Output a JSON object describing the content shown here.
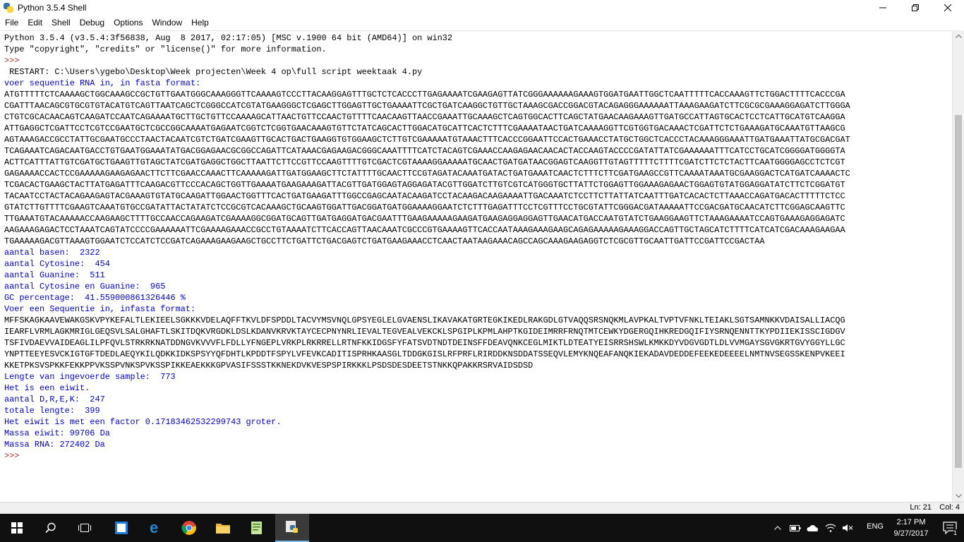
{
  "window": {
    "title": "Python 3.5.4 Shell"
  },
  "menu": [
    "File",
    "Edit",
    "Shell",
    "Debug",
    "Options",
    "Window",
    "Help"
  ],
  "shell": {
    "lines": [
      {
        "type": "output",
        "text": "Python 3.5.4 (v3.5.4:3f56838, Aug  8 2017, 02:17:05) [MSC v.1900 64 bit (AMD64)] on win32"
      },
      {
        "type": "output",
        "text": "Type \"copyright\", \"credits\" or \"license()\" for more information."
      },
      {
        "type": "prompt",
        "text": ">>> "
      },
      {
        "type": "output",
        "text": " RESTART: C:\\Users\\ygebo\\Desktop\\Week projecten\\Week 4 op\\full script weektaak 4.py"
      },
      {
        "type": "blue",
        "text": "voer sequentie RNA in, in fasta format:"
      },
      {
        "type": "output",
        "text": "ATGTTTTTCTCAAAAGCTGGCAAAGCCGCTGTTGAATGGGCAAAGGGTTCAAAAGTCCCTTACAAGGAGTTTGCTCTCACCCTTGAGAAAATCGAAGAGTTATCGGGAAAAAAGAAAGTGGATGAATTGGCTCAATTTTTCACCAAAGTTCTGGACTTTTCACCCGA"
      },
      {
        "type": "output",
        "text": "CGATTTAACAGCGTGCGTGTACATGTCAGTTAATCAGCTCGGGCCATCGTATGAAGGGCTCGAGCTTGGAGTTGCTGAAAATTCGCTGATCAAGGCTGTTGCTAAAGCGACCGGACGTACAGAGGGAAAAAATTAAAGAAGATCTTCGCGCGAAAGGAGATCTTGGGA"
      },
      {
        "type": "output",
        "text": "CTGTCGCACAACAGTCAAGATCCAATCAGAAAATGCTTGCTGTTCCAAAAGCATTAACTGTTCCAACTGTTTTCAACAAGTTAACCGAAATTGCAAAGCTCAGTGGCACTTCAGCTATGAACAAGAAAGTTGATGCCATTAGTGCACTCCTCATTGCATGTCAAGGA"
      },
      {
        "type": "output",
        "text": "ATTGAGGCTCGATTCCTCGTCCGAATGCTCGCCGGCAAAATGAGAATCGGTCTCGGTGAACAAAGTGTTCTATCAGCACTTGGACATGCATTCACTCTTTCGAAAATAACTGATCAAAAGGTTCGTGGTGACAAACTCGATTCTCTGAAAGATGCAAATGTTAAGCG"
      },
      {
        "type": "output",
        "text": "AGTAAAGACCGCCTATTGCGAATGCCCTAACTACAATCGTCTGATCGAAGTTGCACTGACTGAAGGTGTGGAAGCTCTTGTCGAAAAATGTAAACTTTCACCCGGAATTCCACTGAAACCTATGCTGGCTCACCCTACAAAGGGAAATTGATGAAATTATGCGACGAT"
      },
      {
        "type": "output",
        "text": "TCAGAAATCAGACAATGACCTGTGAATGGAAATATGACGGAGAACGCGGCCAGATTCATAAACGAGAAGACGGGCAAATTTTCATCTACAGTCGAAACCAAGAGAACAACACTACCAAGTACCCCGATATTATCGAAAAAATTTCATCCTGCATCGGGGATGGGGTA"
      },
      {
        "type": "output",
        "text": "ACTTCATTTATTGTCGATGCTGAAGTTGTAGCTATCGATGAGGCTGGCTTAATTCTTCCGTTCCAAGTTTTGTCGACTCGTAAAAGGAAAAATGCAACTGATGATAACGGAGTCAAGGTTGTAGTTTTTCTTTTCGATCTTCTCTACTTCAATGGGGAGCCTCTCGT"
      },
      {
        "type": "output",
        "text": "GAGAAAACCACTCCGAAAAAGAAGAGAACTTCTTCGAACCAAACTTCAAAAAGATTGATGGAAGCTTCTATTTTGCAACTTCCGTAGATACAAATGATACTGATGAAATCAACTCTTTCTTCGATGAAGCCGTTCAAAATAAATGCGAAGGACTCATGATCAAAACTC"
      },
      {
        "type": "output",
        "text": "TCGACACTGAAGCTACTTATGAGATTTCAAGACGTTCCCACAGCTGGTTGAAAATGAAGAAAGATTACGTTGATGGAGTAGGAGATACGTTGGATCTTGTCGTCATGGGTGCTTATTCTGGAGTTGGAAAGAGAACTGGAGTGTATGGAGGATATCTTCTCGGATGT"
      },
      {
        "type": "output",
        "text": "TACAATCCTACTACAGAAGAGTACGAAAGTGTATGCAAGATTGGAACTGGTTTCACTGATGAAGATTTGGCCGAGCAATACAAGATCCTACAAGACAAGAAAATTGACAAATCTCCTTCTTATTATCAATTTGATCACACTCTTAAACCAGATGACACTTTTTCTCC"
      },
      {
        "type": "output",
        "text": "GTATCTTGTTTTCGAAGTCAAATGTGCCGATATTACTATATCTCCGCGTCACAAAGCTGCAAGTGGATTGACGGATGATGGAAAAGGAATCTCTTTGAGATTTCCTCGTTTCCTGCGTATTCGGGACGATAAAAATTCCGACGATGCAACATCTTCGGAGCAAGTTC"
      },
      {
        "type": "output",
        "text": "TTGAAATGTACAAAAACCAAGAAGCTTTTGCCAACCAGAAGATCGAAAAGGCGGATGCAGTTGATGAGGATGACGAATTTGAAGAAAAAGAAGATGAAGAGGAGGAGTTGAACATGACCAATGTATCTGAAGGAAGTTCTAAAGAAAATCCAGTGAAAGAGGAGATC"
      },
      {
        "type": "output",
        "text": "AAGAAAGAGACTCCTAAATCAGTATCCCCGAAAAAATTCGAAAAGAAACCGCCTGTAAAATCTTCACCAGTTAACAAATCGCCCGTGAAAAGTTCACCAATAAAGAAAGAAGCAGAGAAAAAGAAAGGACCAGTTGCTAGCATCTTTTCATCATCGACAAAGAAGAA"
      },
      {
        "type": "output",
        "text": "TGAAAAAGACGTTAAAGTGGAATCTCCATCTCCGATCAGAAAGAAGAAGCTGCCTTCTGATTCTGACGAGTCTGATGAAGAAACCTCAACTAATAAGAAACAGCCAGCAAAGAAGAGGTCTCGCGTTGCAATTGATTCCGATTCCGACTAA"
      },
      {
        "type": "blue",
        "text": "aantal basen:  2322"
      },
      {
        "type": "blue",
        "text": "aantal Cytosine:  454"
      },
      {
        "type": "blue",
        "text": "aantal Guanine:  511"
      },
      {
        "type": "blue",
        "text": "aantal Cytosine en Guanine:  965"
      },
      {
        "type": "blue",
        "text": "GC percentage:  41.559000861326446 %"
      },
      {
        "type": "blue",
        "text": "Voer een Sequentie in, infasta format:"
      },
      {
        "type": "output",
        "text": "MFFSKAGKAAVEWAKGSKVPYKEFALTLEKIEELSGKKKVDELAQFFTKVLDFSPDDLTACVYMSVNQLGPSYEGLELGVAENSLIKAVAKATGRTEGKIKEDLRAKGDLGTVAQQSRSNQKMLAVPKALTVPTVFNKLTEIAKLSGTSAMNKKVDAISALLIACQG"
      },
      {
        "type": "output",
        "text": "IEARFLVRMLAGKMRIGLGEQSVLSALGHAFTLSKITDQKVRGDKLDSLKDANVKRVKTAYCECPNYNRLIEVALTEGVEALVEKCKLSPGIPLKPMLAHPTKGIDEIMRRFRNQTMTCEWKYDGERGQIHKREDGQIFIYSRNQENNTTKYPDIIEKISSCIGDGV"
      },
      {
        "type": "output",
        "text": "TSFIVDAEVVAIDEAGLILPFQVLSTRKRKNATDDNGVKVVVFLFDLLYFNGEPLVRKPLRKRRELLRTNFKKIDGSFYFATSVDTNDTDEINSFFDEAVQNKCEGLMIKTLDTEATYEISRRSHSWLKMKKDYVDGVGDTLDLVVMGAYSGVGKRTGVYGGYLLGC"
      },
      {
        "type": "output",
        "text": "YNPTTEEYESVCKIGTGFTDEDLAEQYKILQDKKIDKSPSYYQFDHTLKPDDTFSPYLVFEVKCADITISPRHKAASGLTDDGKGISLRFPRFLRIRDDKNSDDATSSEQVLEMYKNQEAFANQKIEKADAVDEDDEFEEKEDEEEELNMTNVSEGSSKENPVKEEI"
      },
      {
        "type": "output",
        "text": "KKETPKSVSPKKFEKKPPVKSSPVNKSPVKSSPIKKEAEKKKGPVASIFSSSTKKNEKDVKVESPSPIRKKKLPSDSDESDEETSTNKKQPAKKRSRVAIDSDSD"
      },
      {
        "type": "blue",
        "text": "Lengte van ingevoerde sample:  773"
      },
      {
        "type": "blue",
        "text": "Het is een eiwit."
      },
      {
        "type": "blue",
        "text": "aantal D,R,E,K:  247"
      },
      {
        "type": "blue",
        "text": "totale lengte:  399"
      },
      {
        "type": "blue",
        "text": "Het eiwit is met een factor 0.17183462532299743 groter."
      },
      {
        "type": "blue",
        "text": "Massa eiwit: 99706 Da"
      },
      {
        "type": "blue",
        "text": "Massa RNA: 272402 Da"
      },
      {
        "type": "prompt",
        "text": ">>> "
      }
    ]
  },
  "status": {
    "line": "Ln: 21",
    "col": "Col: 4"
  },
  "taskbar": {
    "pinned_icons": [
      "windows-start-icon",
      "search-icon",
      "task-view-icon",
      "sticky-notes-icon",
      "edge-icon",
      "chrome-icon",
      "file-explorer-icon",
      "notepad-plus-plus-icon",
      "python-idle-icon"
    ],
    "language": "ENG",
    "time": "2:17 PM",
    "date": "9/27/2017",
    "notification_count": "1"
  }
}
